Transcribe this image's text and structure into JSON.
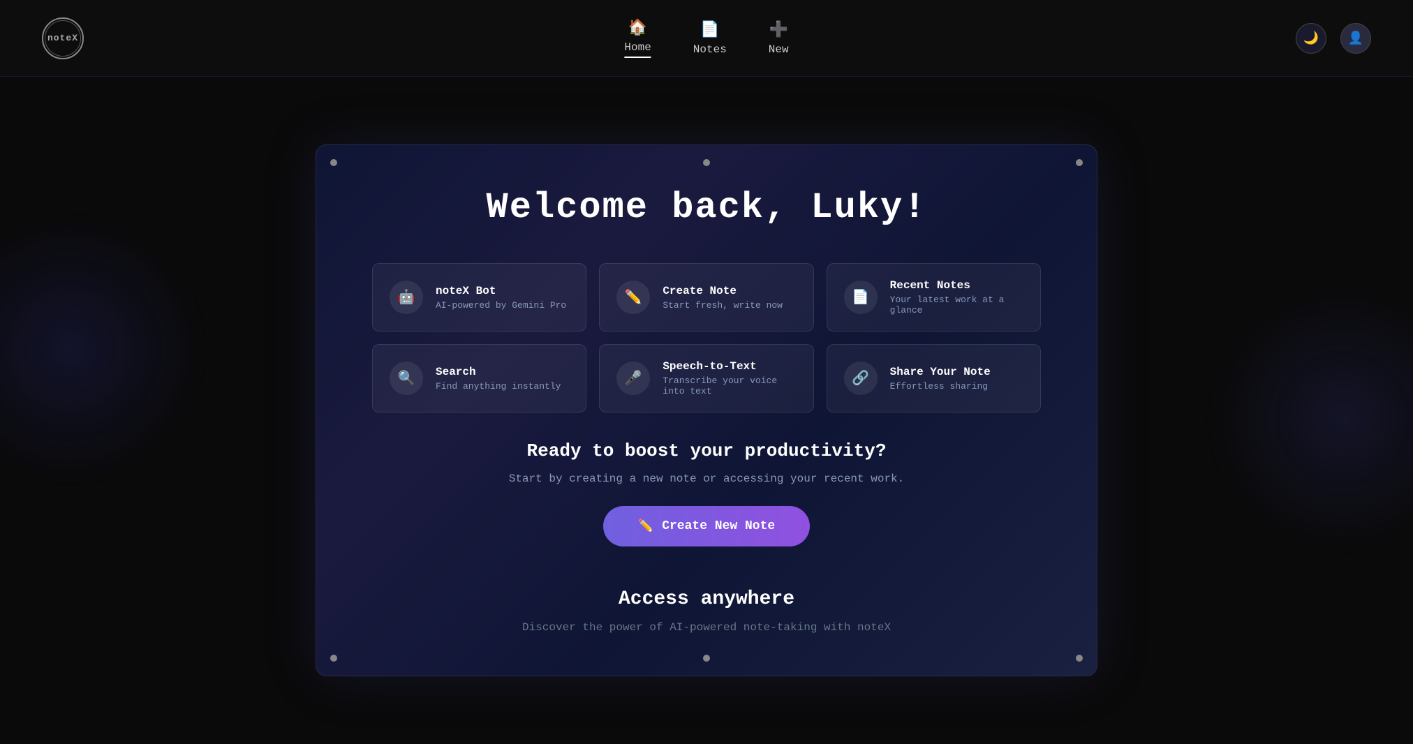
{
  "app": {
    "name": "noteX"
  },
  "navbar": {
    "home_label": "Home",
    "notes_label": "Notes",
    "new_label": "New",
    "theme_icon": "🌙",
    "avatar_icon": "👤"
  },
  "main": {
    "welcome_text": "Welcome back, Luky!",
    "features": [
      {
        "id": "notex-bot",
        "icon": "🤖",
        "title": "noteX Bot",
        "desc": "AI-powered by Gemini Pro"
      },
      {
        "id": "create-note",
        "icon": "✏️",
        "title": "Create Note",
        "desc": "Start fresh, write now"
      },
      {
        "id": "recent-notes",
        "icon": "📄",
        "title": "Recent Notes",
        "desc": "Your latest work at a glance"
      },
      {
        "id": "search",
        "icon": "🔍",
        "title": "Search",
        "desc": "Find anything instantly"
      },
      {
        "id": "speech-to-text",
        "icon": "🎤",
        "title": "Speech-to-Text",
        "desc": "Transcribe your voice into text"
      },
      {
        "id": "share-note",
        "icon": "🔗",
        "title": "Share Your Note",
        "desc": "Effortless sharing"
      }
    ],
    "cta": {
      "title": "Ready to boost your productivity?",
      "subtitle": "Start by creating a new note or accessing your recent work.",
      "button_label": "Create New Note"
    },
    "access": {
      "title": "Access anywhere",
      "subtitle": "Discover the power of AI-powered note-taking with noteX"
    }
  }
}
